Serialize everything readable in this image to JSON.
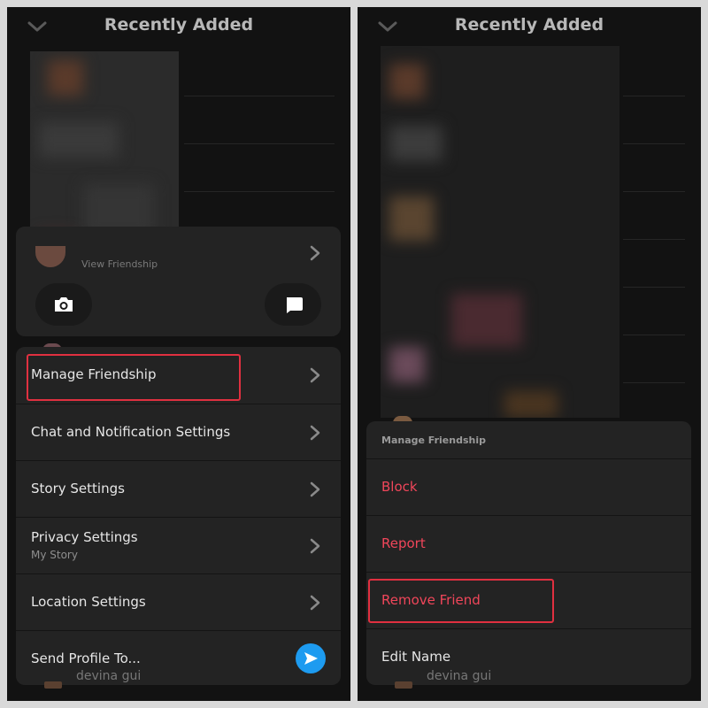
{
  "left": {
    "header": {
      "title": "Recently Added"
    },
    "friend_card": {
      "view_friendship": "View Friendship"
    },
    "menu": [
      {
        "label": "Manage Friendship",
        "sub": ""
      },
      {
        "label": "Chat and Notification Settings",
        "sub": ""
      },
      {
        "label": "Story Settings",
        "sub": ""
      },
      {
        "label": "Privacy Settings",
        "sub": "My Story"
      },
      {
        "label": "Location Settings",
        "sub": ""
      },
      {
        "label": "Send Profile To...",
        "sub": ""
      }
    ],
    "bottom_name": "devina gui"
  },
  "right": {
    "header": {
      "title": "Recently Added"
    },
    "sheet": {
      "title": "Manage Friendship",
      "items": [
        "Block",
        "Report",
        "Remove Friend",
        "Edit Name"
      ]
    },
    "bottom_name": "devina gui"
  },
  "colors": {
    "background": "#121212",
    "card": "#232323",
    "danger": "#f0465a",
    "highlight": "#e03040",
    "send_button": "#1d9bf0"
  },
  "icons": [
    "chevron-down-icon",
    "chevron-right-icon",
    "camera-icon",
    "chat-icon",
    "send-icon"
  ]
}
